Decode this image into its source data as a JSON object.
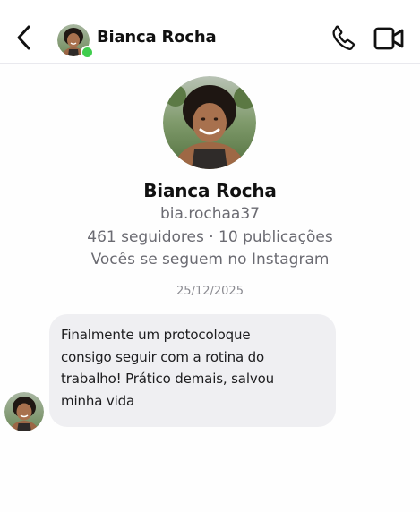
{
  "header": {
    "contact_name": "Bianca Rocha",
    "status_color": "#3fcd4d",
    "icons": {
      "back": "chevron-left-icon",
      "call": "phone-icon",
      "video": "video-camera-icon"
    }
  },
  "profile": {
    "name": "Bianca Rocha",
    "username": "bia.rochaa37",
    "stats": "461 seguidores · 10 publicações",
    "mutual_text": "Vocês se seguem no Instagram"
  },
  "conversation": {
    "date": "25/12/2025",
    "messages": [
      {
        "sender": "Bianca Rocha",
        "text": "Finalmente um protocoloque\nconsigo seguir com a rotina do\ntrabalho! Prático demais, salvou\nminha vida"
      }
    ]
  }
}
